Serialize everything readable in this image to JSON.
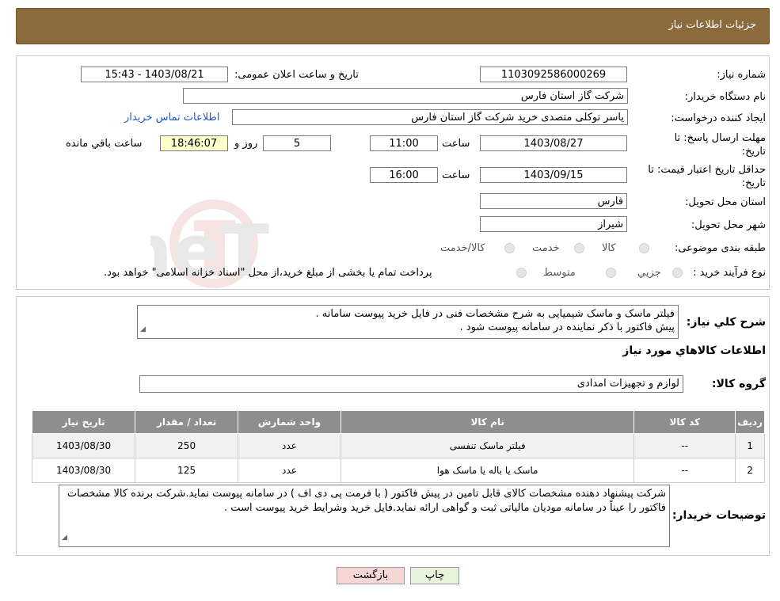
{
  "header": {
    "title": "جزئیات اطلاعات نیاز"
  },
  "fields": {
    "need_number_label": "شماره نیاز:",
    "need_number": "1103092586000269",
    "announce_label": "تاریخ و ساعت اعلان عمومی:",
    "announce_value": "1403/08/21 - 15:43",
    "buyer_org_label": "نام دستگاه خریدار:",
    "buyer_org": "شرکت گاز استان فارس",
    "creator_label": "ایجاد کننده درخواست:",
    "creator": "یاسر توکلی متصدی خرید شرکت گاز استان فارس",
    "contact_link": "اطلاعات تماس خریدار",
    "deadline_label": "مهلت ارسال پاسخ: تا تاریخ:",
    "deadline_date": "1403/08/27",
    "time_label": "ساعت",
    "deadline_time": "11:00",
    "days": "5",
    "days_label": "روز و",
    "remaining": "18:46:07",
    "remaining_label": "ساعت باقي مانده",
    "validity_label": "حداقل تاریخ اعتبار قیمت: تا تاریخ:",
    "validity_date": "1403/09/15",
    "validity_time": "16:00",
    "province_label": "استان محل تحویل:",
    "province": "فارس",
    "city_label": "شهر محل تحویل:",
    "city": "شیراز",
    "category_label": "طبقه بندی موضوعی:",
    "category_options": [
      "کالا",
      "خدمت",
      "کالا/خدمت"
    ],
    "process_label": "نوع فرآیند خرید :",
    "process_options": [
      "جزيي",
      "متوسط"
    ],
    "process_note": "پرداخت تمام یا بخشی از مبلغ خرید،از محل \"اسناد خزانه اسلامی\" خواهد بود."
  },
  "summary": {
    "label": "شرح كلي نياز:",
    "line1": "فیلتر ماسک و ماسک شیمیایی به شرح مشخصات فنی در فایل خرید پیوست سامانه .",
    "line2": "پیش فاکتور با ذکر نماینده در سامانه پیوست شود ."
  },
  "goods": {
    "section_title": "اطلاعات كالاهاي مورد نياز",
    "group_label": "گروه كالا:",
    "group_value": "لوازم و تجهیزات امدادی",
    "columns": [
      "رديف",
      "كد كالا",
      "نام كالا",
      "واحد شمارش",
      "تعداد / مقدار",
      "تاريخ نياز"
    ],
    "rows": [
      [
        "1",
        "--",
        "فیلتر ماسک تنفسی",
        "عدد",
        "250",
        "1403/08/30"
      ],
      [
        "2",
        "--",
        "ماسک یا باله یا ماسک هوا",
        "عدد",
        "125",
        "1403/08/30"
      ]
    ]
  },
  "buyer_notes": {
    "label": "توضیحات خریدار:",
    "text": "شرکت پیشنهاد دهنده مشخصات کالای قابل تامین در پیش فاکتور ( با فرمت پی دی اف ) در سامانه پیوست نماید.شرکت برنده کالا مشخصات فاکتور را عیناً در سامانه مودیان مالیاتی ثبت و گواهی ارائه نماید.فایل خرید وشرایط خرید پیوست است ."
  },
  "buttons": {
    "print": "چاپ",
    "back": "بازگشت"
  },
  "watermark": {
    "text": "AriaTender.neT"
  },
  "colors": {
    "header_bg": "#8b6b3d",
    "table_head": "#8e8e8e",
    "back_btn": "#f7d6d6",
    "print_btn": "#e8f5dc",
    "link": "#2255cc"
  }
}
